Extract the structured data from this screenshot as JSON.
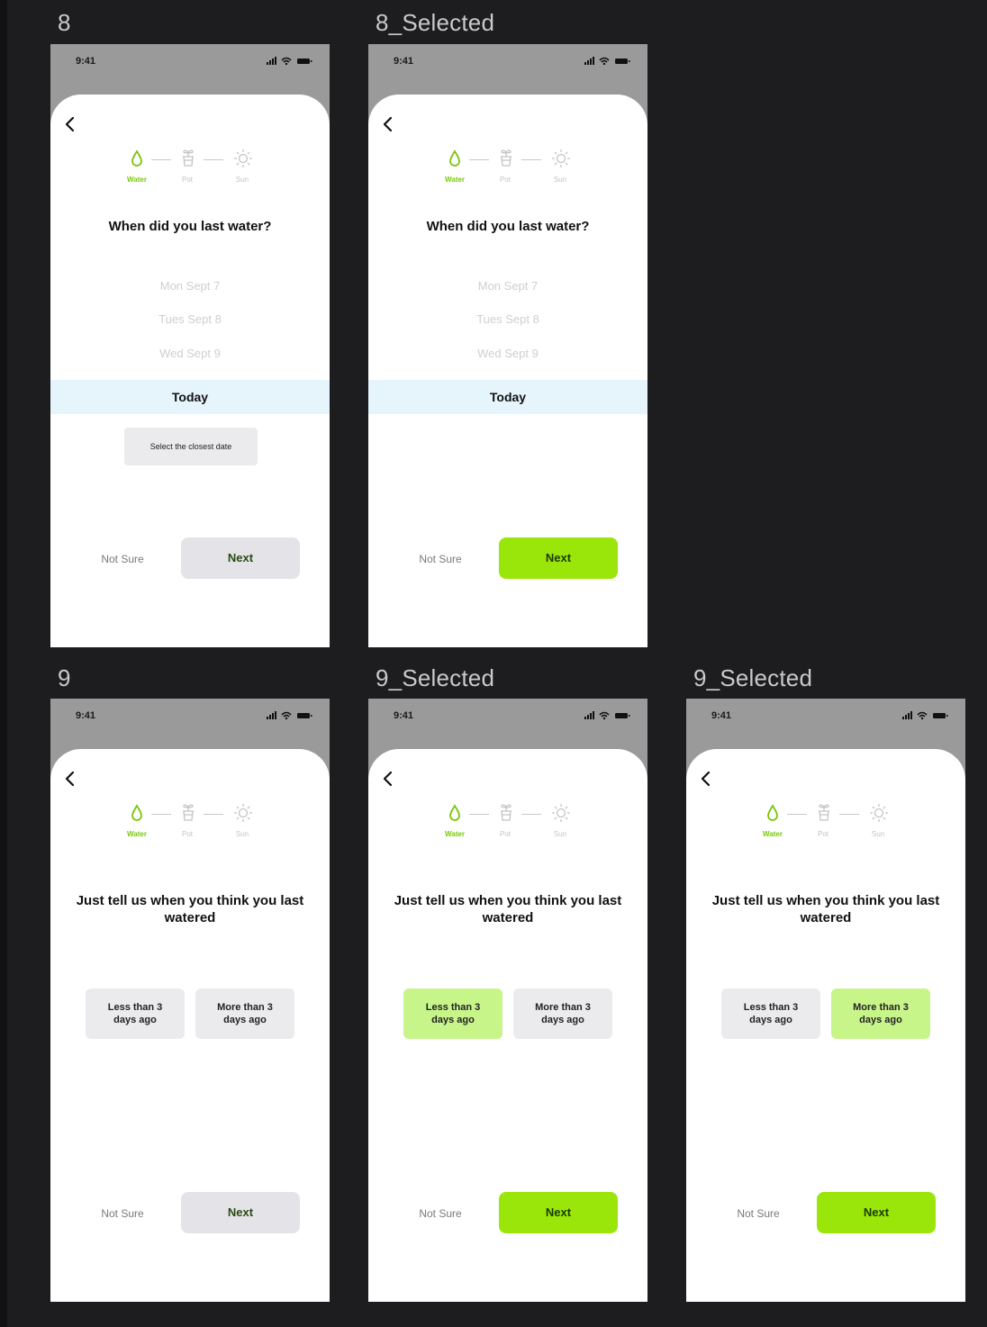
{
  "colors": {
    "canvas": "#1d1d1f",
    "accent_green": "#9be60a",
    "selected_option": "#c8f58a",
    "today_highlight": "#e6f5fb",
    "step_active": "#7ac70c"
  },
  "status": {
    "time": "9:41"
  },
  "stepper": {
    "water": "Water",
    "pot": "Pot",
    "sun": "Sun"
  },
  "common": {
    "not_sure": "Not Sure",
    "next": "Next",
    "back_icon": "chevron-left-icon"
  },
  "frames": {
    "f8": {
      "label": "8",
      "title": "When did you last water?",
      "dates": [
        "Mon Sept 7",
        "Tues Sept 8",
        "Wed Sept 9"
      ],
      "today": "Today",
      "tooltip": "Select the closest date",
      "next_enabled": false
    },
    "f8s": {
      "label": "8_Selected",
      "title": "When did you last water?",
      "dates": [
        "Mon Sept 7",
        "Tues Sept 8",
        "Wed Sept 9"
      ],
      "today": "Today",
      "next_enabled": true
    },
    "f9": {
      "label": "9",
      "title": "Just tell us when you think you last watered",
      "options": [
        "Less than 3\ndays ago",
        "More than 3\ndays ago"
      ],
      "selected": null,
      "next_enabled": false
    },
    "f9s1": {
      "label": "9_Selected",
      "title": "Just tell us when you think you last watered",
      "options": [
        "Less than 3\ndays ago",
        "More than 3\ndays ago"
      ],
      "selected": "Less than 3 days ago",
      "next_enabled": true
    },
    "f9s2": {
      "label": "9_Selected",
      "title": "Just tell us when you think you last watered",
      "options": [
        "Less than 3\ndays ago",
        "More than 3\ndays ago"
      ],
      "selected": "More than 3 days ago",
      "next_enabled": true
    }
  }
}
